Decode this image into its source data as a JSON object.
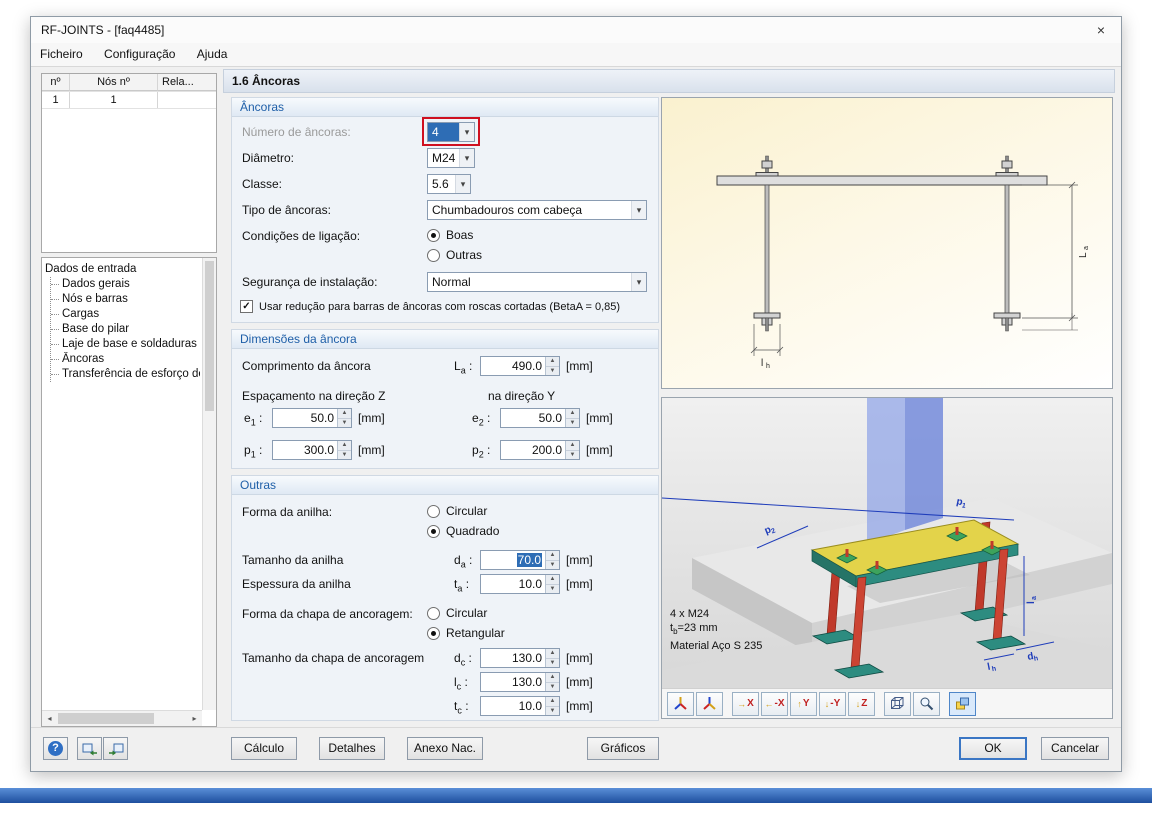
{
  "window": {
    "title": "RF-JOINTS - [faq4485]"
  },
  "icons": {
    "close": "×",
    "dropdown": "▾",
    "check": "✓",
    "spin_up": "▲",
    "spin_down": "▼",
    "scroll_left": "◂",
    "scroll_right": "▸"
  },
  "menu": {
    "items": [
      "Ficheiro",
      "Configuração",
      "Ajuda"
    ]
  },
  "nodes_table": {
    "headers": [
      "nº",
      "Nós nº",
      "Rela..."
    ],
    "row": [
      "1",
      "1"
    ]
  },
  "tree": {
    "root": "Dados de entrada",
    "items": [
      "Dados gerais",
      "Nós e barras",
      "Cargas",
      "Base do pilar",
      "Laje de base e soldaduras",
      "Âncoras",
      "Transferência de esforço de co"
    ]
  },
  "page": {
    "title": "1.6 Âncoras"
  },
  "punct": {
    "colon": ":"
  },
  "units": {
    "mm": "[mm]"
  },
  "anchors": {
    "title": "Âncoras",
    "num_label": "Número de âncoras:",
    "num_value": "4",
    "diam_label": "Diâmetro:",
    "diam_value": "M24",
    "class_label": "Classe:",
    "class_value": "5.6",
    "type_label": "Tipo de âncoras:",
    "type_value": "Chumbadouros com cabeça",
    "cond_label": "Condições de ligação:",
    "cond_opt1": "Boas",
    "cond_opt2": "Outras",
    "safety_label": "Segurança de instalação:",
    "safety_value": "Normal",
    "reduction_label": "Usar redução para barras de âncoras com roscas cortadas (BetaA = 0,85)"
  },
  "dims": {
    "title": "Dimensões da âncora",
    "length_label": "Comprimento da âncora",
    "length_sym": "L",
    "length_sub": "a",
    "length_value": "490.0",
    "spacing_z_label": "Espaçamento na direção Z",
    "spacing_y_label": "na direção Y",
    "e1_sym": "e",
    "e1_sub": "1",
    "e1_value": "50.0",
    "e2_sym": "e",
    "e2_sub": "2",
    "e2_value": "50.0",
    "p1_sym": "p",
    "p1_sub": "1",
    "p1_value": "300.0",
    "p2_sym": "p",
    "p2_sub": "2",
    "p2_value": "200.0"
  },
  "other": {
    "title": "Outras",
    "washer_shape_label": "Forma da anilha:",
    "opt_circular": "Circular",
    "opt_square": "Quadrado",
    "washer_size_label": "Tamanho da anilha",
    "washer_size_sym": "d",
    "washer_size_sub": "a",
    "washer_size_value": "70.0",
    "washer_thick_label": "Espessura da anilha",
    "washer_thick_sym": "t",
    "washer_thick_sub": "a",
    "washer_thick_value": "10.0",
    "plate_shape_label": "Forma da chapa de ancoragem:",
    "opt_circular2": "Circular",
    "opt_rect": "Retangular",
    "plate_size_label": "Tamanho da chapa de ancoragem",
    "dc_sym": "d",
    "dc_sub": "c",
    "dc_value": "130.0",
    "lc_sym": "l",
    "lc_sub": "c",
    "lc_value": "130.0",
    "tc_sym": "t",
    "tc_sub": "c",
    "tc_value": "10.0"
  },
  "preview": {
    "info1": "4 x M24",
    "info2_sym": "t",
    "info2_sub": "b",
    "info2_rest": "=23 mm",
    "info3": "Material Aço S 235",
    "labels": {
      "p1s": "p",
      "p1b": "1",
      "p2s": "p",
      "p2b": "2",
      "las": "l",
      "lab": "a",
      "lhs": "l",
      "lhb": "h",
      "dhs": "d",
      "dhb": "h",
      "Las": "L",
      "Lab": "a"
    }
  },
  "view_toolbar": {
    "x": "X",
    "minus_x": "-X",
    "y": "Y",
    "minus_y": "-Y",
    "z": "Z",
    "arrow_right": "→",
    "arrow_left": "←",
    "arrow_up": "↑",
    "arrow_down": "↓"
  },
  "footer": {
    "help": "?",
    "calc": "Cálculo",
    "details": "Detalhes",
    "annex": "Anexo Nac.",
    "graphics": "Gráficos",
    "ok": "OK",
    "cancel": "Cancelar"
  }
}
